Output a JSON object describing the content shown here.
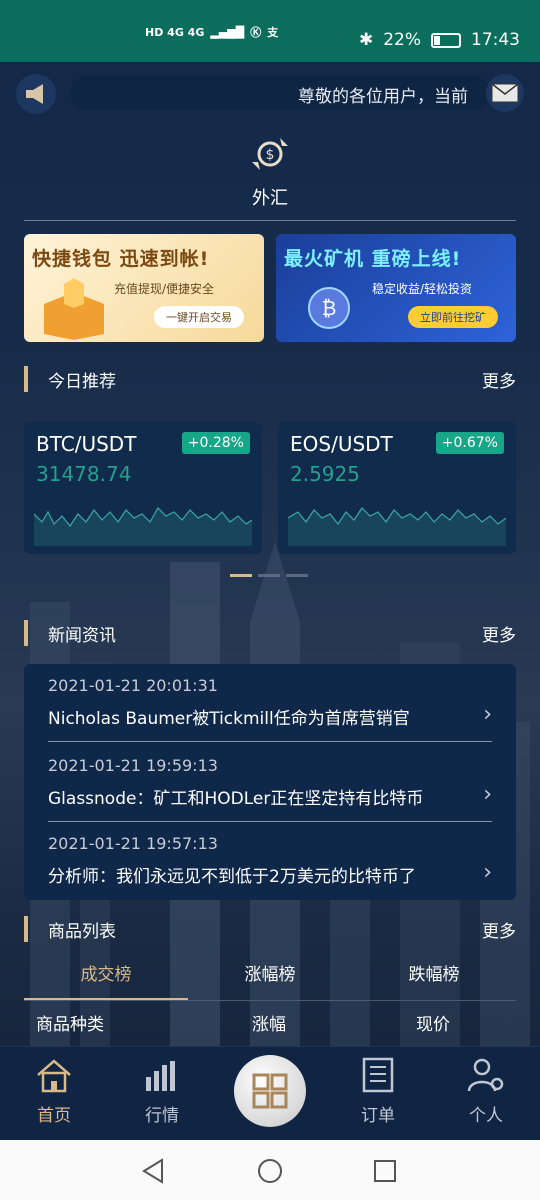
{
  "status_bar": {
    "signal_text": "HD 4G 4G",
    "battery": "22%",
    "time": "17:43"
  },
  "notice": {
    "text": "尊敬的各位用户，当前"
  },
  "forex": {
    "label": "外汇"
  },
  "banners": [
    {
      "title": "快捷钱包 迅速到帐!",
      "subtitle": "充值提现/便捷安全",
      "button": "一键开启交易"
    },
    {
      "title": "最火矿机 重磅上线!",
      "subtitle": "稳定收益/轻松投资",
      "button": "立即前往挖矿"
    }
  ],
  "today": {
    "title": "今日推荐",
    "more": "更多"
  },
  "cards": [
    {
      "pair": "BTC/USDT",
      "change": "+0.28%",
      "price": "31478.74"
    },
    {
      "pair": "EOS/USDT",
      "change": "+0.67%",
      "price": "2.5925"
    }
  ],
  "news": {
    "title": "新闻资讯",
    "more": "更多",
    "items": [
      {
        "date": "2021-01-21 20:01:31",
        "headline": "Nicholas Baumer被Tickmill任命为首席营销官"
      },
      {
        "date": "2021-01-21 19:59:13",
        "headline": "Glassnode：矿工和HODLer正在坚定持有比特币"
      },
      {
        "date": "2021-01-21 19:57:13",
        "headline": "分析师：我们永远见不到低于2万美元的比特币了"
      }
    ]
  },
  "products": {
    "title": "商品列表",
    "more": "更多",
    "tabs": [
      "成交榜",
      "涨幅榜",
      "跌幅榜"
    ],
    "columns": [
      "商品种类",
      "涨幅",
      "现价"
    ]
  },
  "nav": {
    "home": "首页",
    "market": "行情",
    "orders": "订单",
    "profile": "个人"
  },
  "colors": {
    "accent": "#d9b98a",
    "positive": "#17a688",
    "statusbar": "#0b6e5c"
  }
}
